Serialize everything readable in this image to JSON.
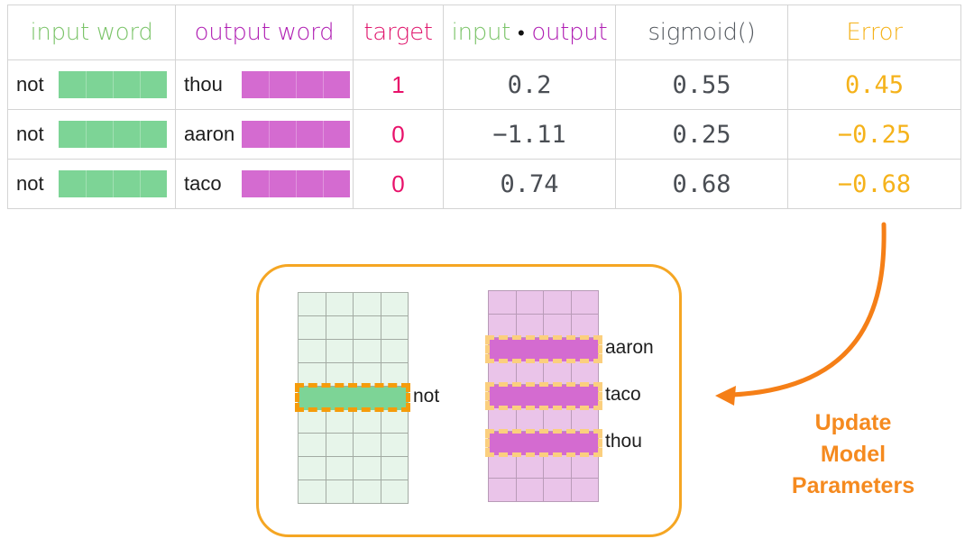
{
  "colors": {
    "input_green": "#7cc46a",
    "output_purple": "#b01fb3",
    "target_pink": "#e8116a",
    "error_yellow": "#f5b21a",
    "update_orange": "#f58a1f",
    "box_border": "#f5a623",
    "swatch_green": "#7dd496",
    "swatch_purple": "#d46bd0"
  },
  "table": {
    "headers": {
      "input_word": "input word",
      "output_word": "output word",
      "target": "target",
      "dot_input": "input",
      "dot_symbol": "•",
      "dot_output": "output",
      "sigmoid": "sigmoid()",
      "error": "Error"
    },
    "rows": [
      {
        "input_word": "not",
        "output_word": "thou",
        "target": "1",
        "dot": "0.2",
        "sigmoid": "0.55",
        "error": "0.45"
      },
      {
        "input_word": "not",
        "output_word": "aaron",
        "target": "0",
        "dot": "−1.11",
        "sigmoid": "0.25",
        "error": "−0.25"
      },
      {
        "input_word": "not",
        "output_word": "taco",
        "target": "0",
        "dot": "0.74",
        "sigmoid": "0.68",
        "error": "−0.68"
      }
    ]
  },
  "update_panel": {
    "embedding_matrix": {
      "highlighted_label": "not"
    },
    "context_matrix": {
      "highlighted_labels": [
        "aaron",
        "taco",
        "thou"
      ]
    }
  },
  "update_label": {
    "line1": "Update",
    "line2": "Model",
    "line3": "Parameters"
  }
}
